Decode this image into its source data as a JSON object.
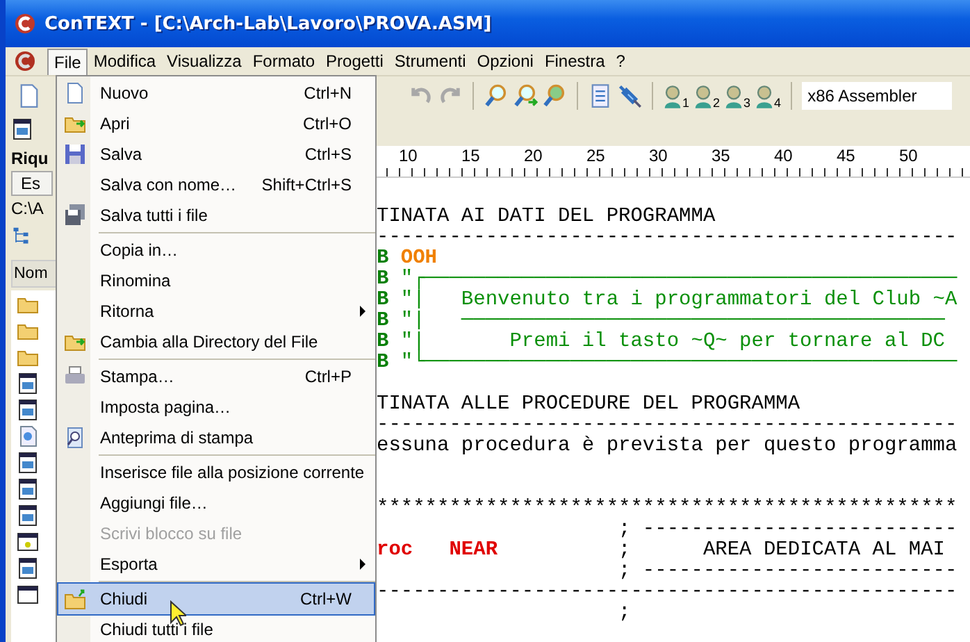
{
  "window": {
    "title": "ConTEXT - [C:\\Arch-Lab\\Lavoro\\PROVA.ASM]"
  },
  "menu_bar": [
    {
      "label": "File",
      "selected": true
    },
    {
      "label": "Modifica",
      "selected": false
    },
    {
      "label": "Visualizza",
      "selected": false
    },
    {
      "label": "Formato",
      "selected": false
    },
    {
      "label": "Progetti",
      "selected": false
    },
    {
      "label": "Strumenti",
      "selected": false
    },
    {
      "label": "Opzioni",
      "selected": false
    },
    {
      "label": "Finestra",
      "selected": false
    },
    {
      "label": "?",
      "selected": false
    }
  ],
  "toolbar": {
    "user_buttons": [
      "1",
      "2",
      "3",
      "4"
    ],
    "highlighter": "x86 Assembler"
  },
  "side_panel": {
    "title": "Riqu",
    "tab": "Es",
    "path": "C:\\A",
    "column": "Nom"
  },
  "file_menu": [
    [
      {
        "label": "Nuovo",
        "shortcut": "Ctrl+N",
        "submenu": false,
        "disabled": false,
        "selected": false
      },
      {
        "label": "Apri",
        "shortcut": "Ctrl+O",
        "submenu": false,
        "disabled": false,
        "selected": false
      },
      {
        "label": "Salva",
        "shortcut": "Ctrl+S",
        "submenu": false,
        "disabled": false,
        "selected": false
      },
      {
        "label": "Salva con nome…",
        "shortcut": "Shift+Ctrl+S",
        "submenu": false,
        "disabled": false,
        "selected": false
      },
      {
        "label": "Salva tutti i file",
        "submenu": false,
        "disabled": false,
        "selected": false
      }
    ],
    [
      {
        "label": "Copia in…",
        "submenu": false,
        "disabled": false,
        "selected": false
      },
      {
        "label": "Rinomina",
        "submenu": false,
        "disabled": false,
        "selected": false
      },
      {
        "label": "Ritorna",
        "submenu": true,
        "disabled": false,
        "selected": false
      },
      {
        "label": "Cambia alla Directory del File",
        "submenu": false,
        "disabled": false,
        "selected": false
      }
    ],
    [
      {
        "label": "Stampa…",
        "shortcut": "Ctrl+P",
        "submenu": false,
        "disabled": false,
        "selected": false
      },
      {
        "label": "Imposta pagina…",
        "submenu": false,
        "disabled": false,
        "selected": false
      },
      {
        "label": "Anteprima di stampa",
        "submenu": false,
        "disabled": false,
        "selected": false
      }
    ],
    [
      {
        "label": "Inserisce file alla posizione corrente",
        "submenu": false,
        "disabled": false,
        "selected": false
      },
      {
        "label": "Aggiungi file…",
        "submenu": false,
        "disabled": false,
        "selected": false
      },
      {
        "label": "Scrivi blocco su file",
        "submenu": false,
        "disabled": true,
        "selected": false
      },
      {
        "label": "Esporta",
        "submenu": true,
        "disabled": false,
        "selected": false
      }
    ],
    [
      {
        "label": "Chiudi",
        "shortcut": "Ctrl+W",
        "submenu": false,
        "disabled": false,
        "selected": true
      },
      {
        "label": "Chiudi tutti i file",
        "submenu": false,
        "disabled": false,
        "selected": false
      }
    ]
  ],
  "ruler": [
    "10",
    "15",
    "20",
    "25",
    "30",
    "35",
    "40",
    "45",
    "50"
  ],
  "code_lines": [
    [
      {
        "text": "TINATA AI DATI DEL PROGRAMMA",
        "kind": "plain"
      }
    ],
    [
      {
        "text": "------------------------------------------------",
        "kind": "plain"
      }
    ],
    [
      {
        "text": "B ",
        "kind": "keyword"
      },
      {
        "text": "OOH",
        "kind": "number"
      }
    ],
    [
      {
        "text": "B ",
        "kind": "keyword"
      },
      {
        "text": "\"┌────────────────────────────────────────────",
        "kind": "string"
      }
    ],
    [
      {
        "text": "B ",
        "kind": "keyword"
      },
      {
        "text": "\"|   Benvenuto tra i programmatori del Club ~A",
        "kind": "string"
      }
    ],
    [
      {
        "text": "B ",
        "kind": "keyword"
      },
      {
        "text": "\"|   ────────────────────────────────────────",
        "kind": "string"
      }
    ],
    [
      {
        "text": "B ",
        "kind": "keyword"
      },
      {
        "text": "\"|       Premi il tasto ~Q~ per tornare al DC",
        "kind": "string"
      }
    ],
    [
      {
        "text": "B ",
        "kind": "keyword"
      },
      {
        "text": "\"└────────────────────────────────────────────",
        "kind": "string"
      }
    ],
    [
      {
        "text": "TINATA ALLE PROCEDURE DEL PROGRAMMA",
        "kind": "plain"
      }
    ],
    [
      {
        "text": "------------------------------------------------",
        "kind": "plain"
      }
    ],
    [
      {
        "text": "essuna procedura è prevista per questo programma",
        "kind": "plain"
      }
    ],
    [
      {
        "text": "************************************************",
        "kind": "plain"
      }
    ],
    [
      {
        "text": "                    ; --------------------------",
        "kind": "plain"
      }
    ],
    [
      {
        "text": "roc",
        "kind": "proc"
      },
      {
        "text": "   NEAR",
        "kind": "proc"
      },
      {
        "text": "          ;      AREA DEDICATA AL MAI",
        "kind": "plain"
      }
    ],
    [
      {
        "text": "                    ; --------------------------",
        "kind": "plain"
      }
    ],
    [
      {
        "text": "------------------------------------------------",
        "kind": "plain"
      }
    ],
    [
      {
        "text": "                    ;",
        "kind": "plain"
      }
    ]
  ]
}
